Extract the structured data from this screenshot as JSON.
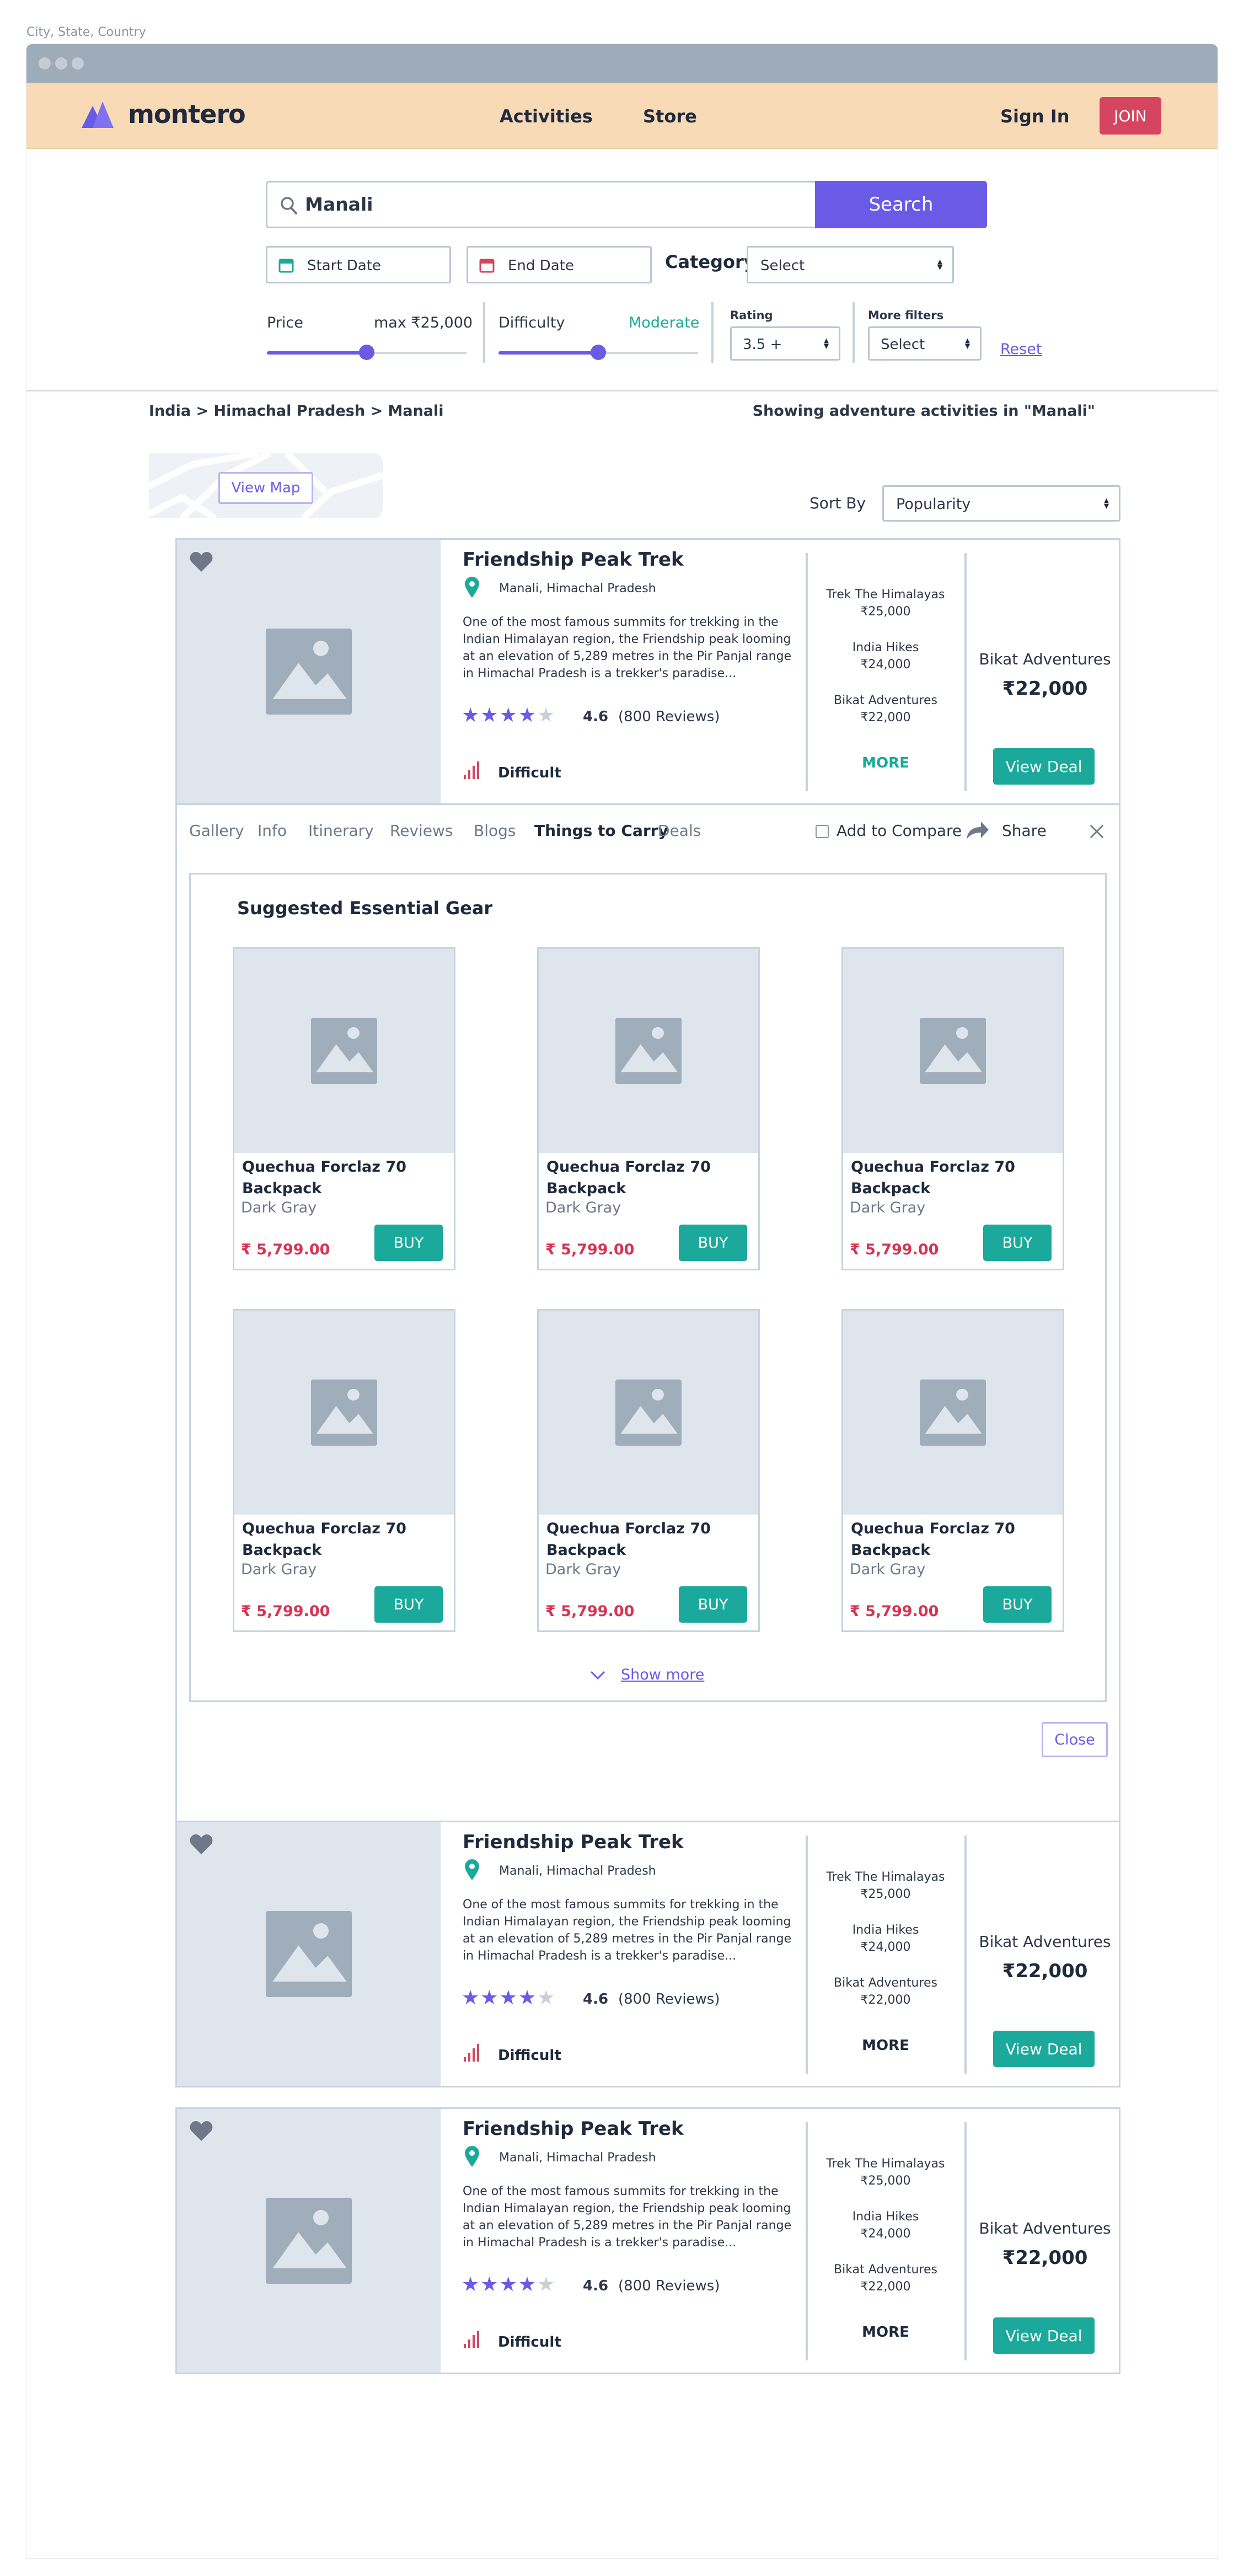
{
  "caption": "City, State, Country",
  "brand": {
    "name": "montero",
    "color": "#6a5be6"
  },
  "nav": {
    "activities": "Activities",
    "store": "Store",
    "sign_in": "Sign In",
    "join": "JOIN"
  },
  "search": {
    "value": "Manali",
    "button": "Search"
  },
  "filters": {
    "start_date": "Start Date",
    "end_date": "End Date",
    "category_label": "Category",
    "category_value": "Select",
    "price_label": "Price",
    "price_max": "max ₹25,000",
    "price_level": 0.5,
    "difficulty_label": "Difficulty",
    "difficulty_value": "Moderate",
    "difficulty_level": 0.5,
    "rating_label": "Rating",
    "rating_value": "3.5 +",
    "more_filters_label": "More filters",
    "more_filters_value": "Select",
    "reset": "Reset"
  },
  "breadcrumb": "India > Himachal Pradesh > Manali",
  "showing": "Showing adventure activities in \"Manali\"",
  "view_map": "View Map",
  "sort": {
    "label": "Sort By",
    "value": "Popularity"
  },
  "listings": [
    {
      "title": "Friendship Peak Trek",
      "location": "Manali, Himachal Pradesh",
      "description": "One of the most famous summits for trekking in the Indian Himalayan region, the Friendship peak looming at an elevation of 5,289 metres in the Pir Panjal range in Himachal Pradesh is a trekker's paradise...",
      "rating": "4.6",
      "stars": 4,
      "reviews": "(800 Reviews)",
      "difficulty": "Difficult",
      "providers": [
        {
          "name": "Trek The Himalayas",
          "price": "₹25,000"
        },
        {
          "name": "India Hikes",
          "price": "₹24,000"
        },
        {
          "name": "Bikat Adventures",
          "price": "₹22,000"
        }
      ],
      "more": "MORE",
      "deal_provider": "Bikat Adventures",
      "deal_price": "₹22,000",
      "deal_button": "View Deal"
    },
    {
      "title": "Friendship Peak Trek",
      "location": "Manali, Himachal Pradesh",
      "description": "One of the most famous summits for trekking in the Indian Himalayan region, the Friendship peak looming at an elevation of 5,289 metres in the Pir Panjal range in Himachal Pradesh is a trekker's paradise...",
      "rating": "4.6",
      "stars": 4,
      "reviews": "(800 Reviews)",
      "difficulty": "Difficult",
      "providers": [
        {
          "name": "Trek The Himalayas",
          "price": "₹25,000"
        },
        {
          "name": "India Hikes",
          "price": "₹24,000"
        },
        {
          "name": "Bikat Adventures",
          "price": "₹22,000"
        }
      ],
      "more": "MORE",
      "deal_provider": "Bikat Adventures",
      "deal_price": "₹22,000",
      "deal_button": "View Deal"
    },
    {
      "title": "Friendship Peak Trek",
      "location": "Manali, Himachal Pradesh",
      "description": "One of the most famous summits for trekking in the Indian Himalayan region, the Friendship peak looming at an elevation of 5,289 metres in the Pir Panjal range in Himachal Pradesh is a trekker's paradise...",
      "rating": "4.6",
      "stars": 4,
      "reviews": "(800 Reviews)",
      "difficulty": "Difficult",
      "providers": [
        {
          "name": "Trek The Himalayas",
          "price": "₹25,000"
        },
        {
          "name": "India Hikes",
          "price": "₹24,000"
        },
        {
          "name": "Bikat Adventures",
          "price": "₹22,000"
        }
      ],
      "more": "MORE",
      "deal_provider": "Bikat Adventures",
      "deal_price": "₹22,000",
      "deal_button": "View Deal"
    }
  ],
  "tabs": [
    "Gallery",
    "Info",
    "Itinerary",
    "Reviews",
    "Blogs",
    "Things to Carry",
    "Deals"
  ],
  "active_tab": "Things to Carry",
  "compare": "Add to Compare",
  "share": "Share",
  "gear_section": {
    "heading": "Suggested Essential Gear",
    "items": [
      {
        "name": "Quechua Forclaz 70 Backpack",
        "color": "Dark Gray",
        "price": "₹ 5,799.00",
        "button": "BUY"
      },
      {
        "name": "Quechua Forclaz 70 Backpack",
        "color": "Dark Gray",
        "price": "₹ 5,799.00",
        "button": "BUY"
      },
      {
        "name": "Quechua Forclaz 70 Backpack",
        "color": "Dark Gray",
        "price": "₹ 5,799.00",
        "button": "BUY"
      },
      {
        "name": "Quechua Forclaz 70 Backpack",
        "color": "Dark Gray",
        "price": "₹ 5,799.00",
        "button": "BUY"
      },
      {
        "name": "Quechua Forclaz 70 Backpack",
        "color": "Dark Gray",
        "price": "₹ 5,799.00",
        "button": "BUY"
      },
      {
        "name": "Quechua Forclaz 70 Backpack",
        "color": "Dark Gray",
        "price": "₹ 5,799.00",
        "button": "BUY"
      }
    ],
    "show_more": "Show more",
    "close": "Close"
  },
  "colors": {
    "accent": "#6a5be6",
    "teal": "#1aa99a",
    "danger": "#d64560",
    "navbar": "#f9dab7"
  }
}
